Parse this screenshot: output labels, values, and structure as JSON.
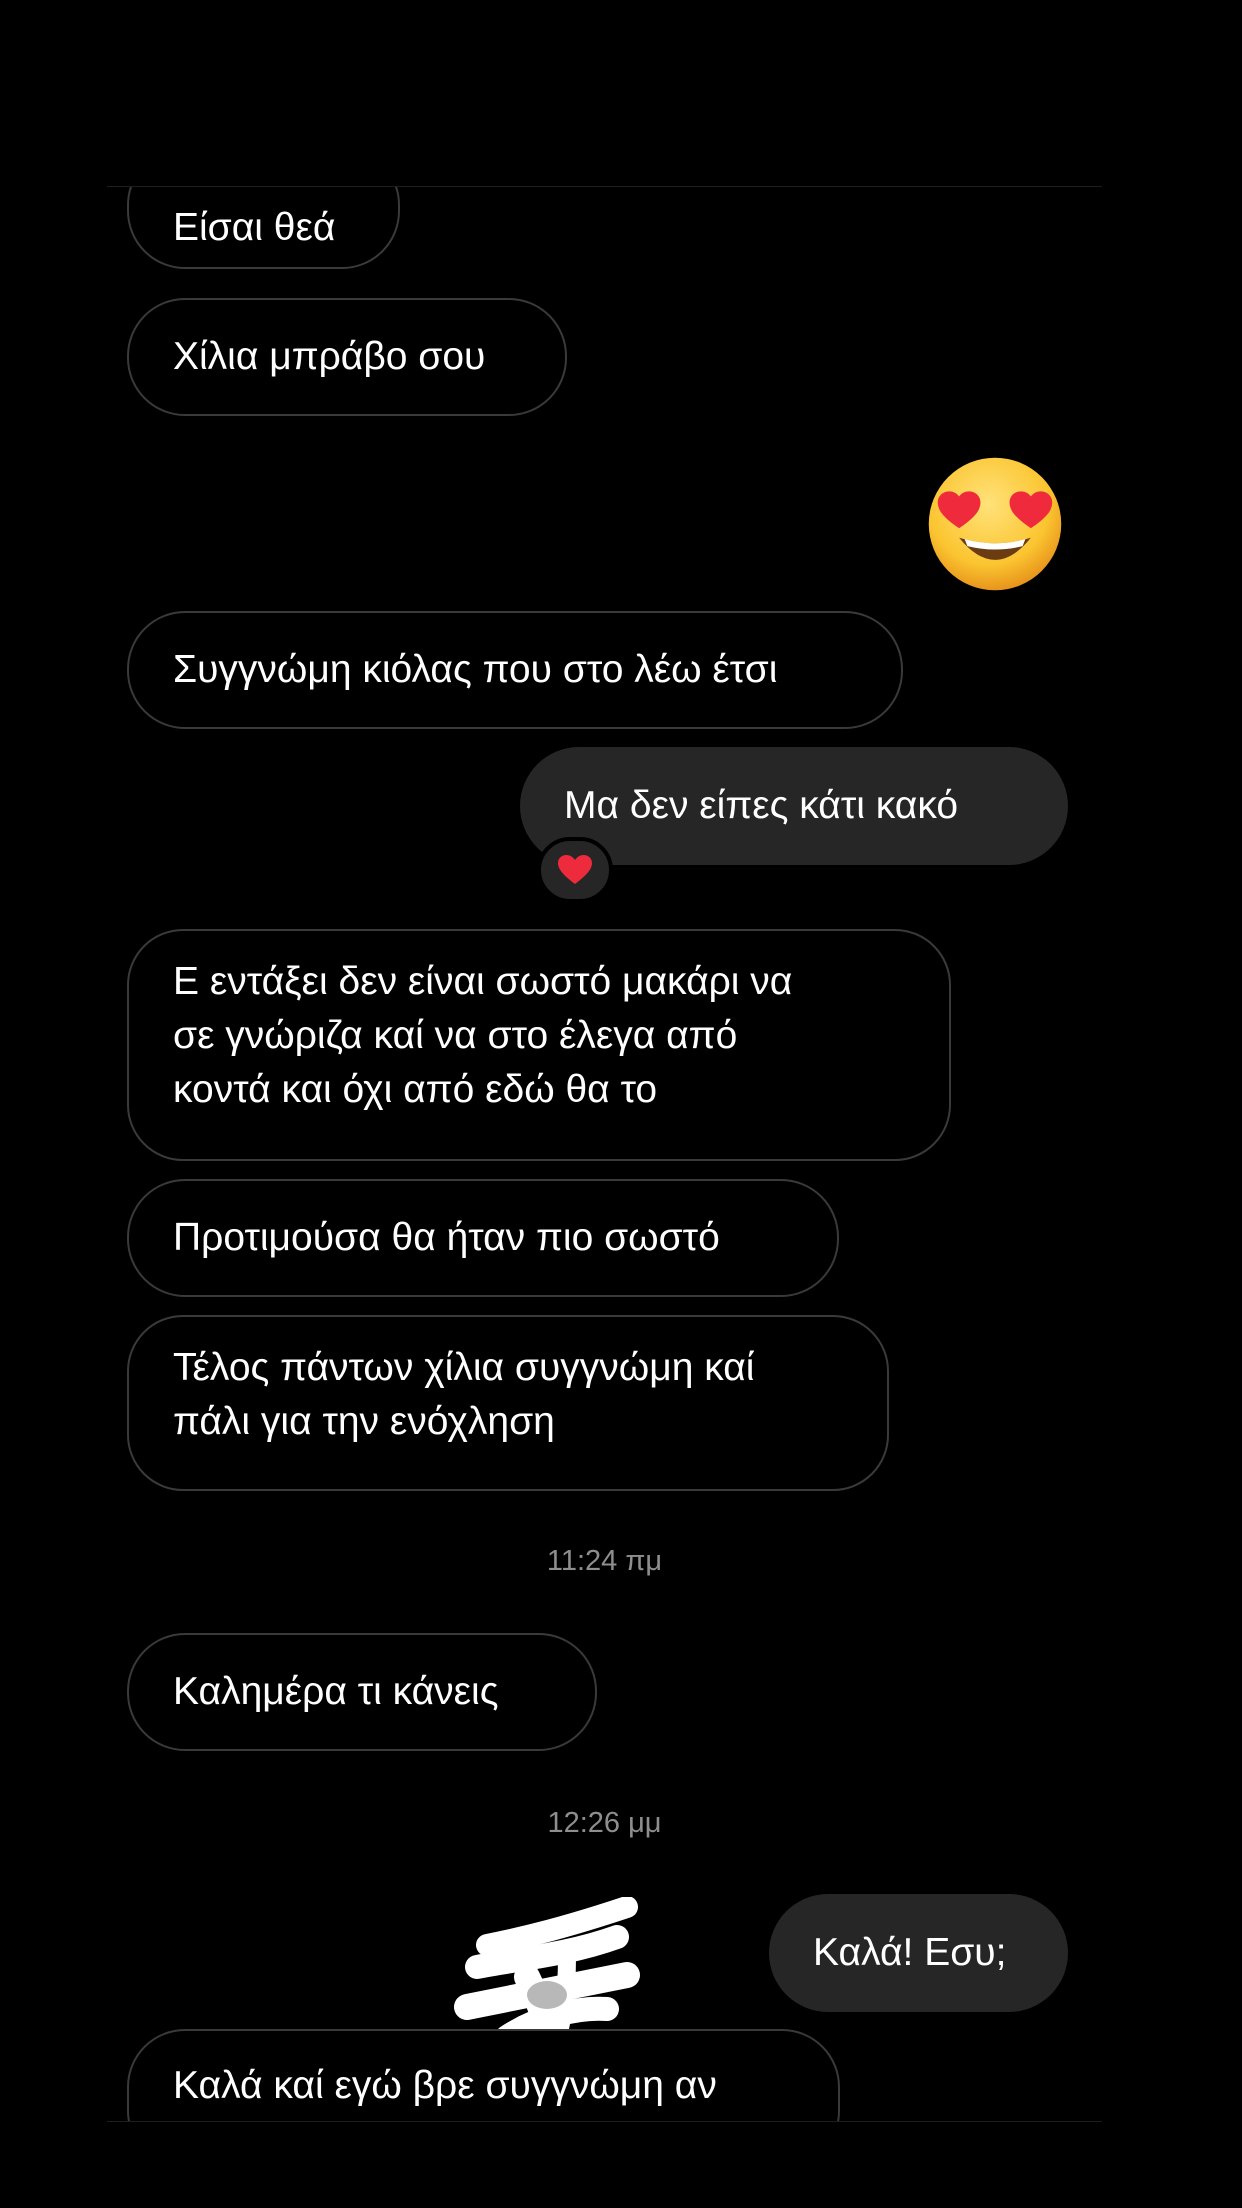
{
  "messages": [
    {
      "id": "m1",
      "side": "in",
      "text": "Είσαι θεά"
    },
    {
      "id": "m2",
      "side": "in",
      "text": "Χίλια μπράβο σου"
    },
    {
      "id": "m3",
      "side": "out",
      "emoji": "heart-eyes-emoji"
    },
    {
      "id": "m4",
      "side": "in",
      "text": "Συγγνώμη κιόλας που στο λέω έτσι"
    },
    {
      "id": "m5",
      "side": "out",
      "text": "Μα δεν είπες κάτι κακό",
      "reaction": "red-heart"
    },
    {
      "id": "m6",
      "side": "in",
      "lines": [
        "Ε  εντάξει δεν είναι σωστό μακάρι να",
        "σε γνώριζα καί να στο έλεγα από",
        "κοντά και όχι από εδώ θα το"
      ]
    },
    {
      "id": "m7",
      "side": "in",
      "text": "Προτιμούσα θα ήταν πιο σωστό"
    },
    {
      "id": "m8",
      "side": "in",
      "lines": [
        "Τέλος πάντων χίλια συγγνώμη καί",
        "πάλι για την ενόχληση"
      ]
    },
    {
      "id": "t1",
      "type": "timestamp",
      "text": "11:24 πμ"
    },
    {
      "id": "m9",
      "side": "in",
      "text": "Καλημέρα τι κάνεις"
    },
    {
      "id": "t2",
      "type": "timestamp",
      "text": "12:26 μμ"
    },
    {
      "id": "m10",
      "side": "out",
      "text": "Καλά! Εσυ;"
    },
    {
      "id": "m11",
      "side": "in",
      "text": "Καλά καί εγώ βρε συγγνώμη αν"
    }
  ],
  "colors": {
    "background": "#000000",
    "incoming_border": "#3a3a3a",
    "outgoing_bubble": "#262626",
    "timestamp": "#8e8e8e",
    "redaction": "#ffffff"
  }
}
